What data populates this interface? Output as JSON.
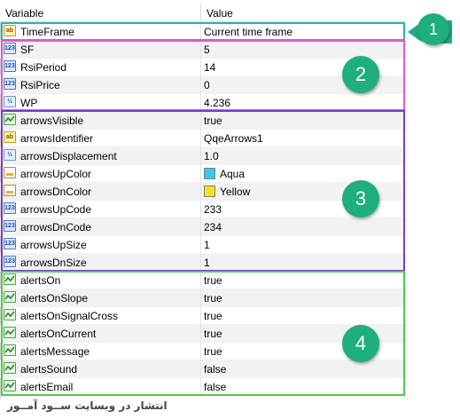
{
  "header": {
    "col1": "Variable",
    "col2": "Value"
  },
  "rows": [
    {
      "icon": "ab",
      "kind": "str",
      "name": "TimeFrame",
      "value": "Current time frame"
    },
    {
      "icon": "123",
      "kind": "num",
      "name": "SF",
      "value": "5"
    },
    {
      "icon": "123",
      "kind": "num",
      "name": "RsiPeriod",
      "value": "14"
    },
    {
      "icon": "123",
      "kind": "num",
      "name": "RsiPrice",
      "value": "0"
    },
    {
      "icon": "½",
      "kind": "dbl",
      "name": "WP",
      "value": "4.236"
    },
    {
      "icon": "bool",
      "kind": "bool",
      "name": "arrowsVisible",
      "value": "true"
    },
    {
      "icon": "ab",
      "kind": "str",
      "name": "arrowsIdentifier",
      "value": "QqeArrows1"
    },
    {
      "icon": "½",
      "kind": "dbl",
      "name": "arrowsDisplacement",
      "value": "1.0"
    },
    {
      "icon": "clr",
      "kind": "clr",
      "name": "arrowsUpColor",
      "value": "Aqua",
      "swatch": "#33ccee"
    },
    {
      "icon": "clr",
      "kind": "clr",
      "name": "arrowsDnColor",
      "value": "Yellow",
      "swatch": "#f5e21a"
    },
    {
      "icon": "123",
      "kind": "num",
      "name": "arrowsUpCode",
      "value": "233"
    },
    {
      "icon": "123",
      "kind": "num",
      "name": "arrowsDnCode",
      "value": "234"
    },
    {
      "icon": "123",
      "kind": "num",
      "name": "arrowsUpSize",
      "value": "1"
    },
    {
      "icon": "123",
      "kind": "num",
      "name": "arrowsDnSize",
      "value": "1"
    },
    {
      "icon": "bool",
      "kind": "bool",
      "name": "alertsOn",
      "value": "true"
    },
    {
      "icon": "bool",
      "kind": "bool",
      "name": "alertsOnSlope",
      "value": "true"
    },
    {
      "icon": "bool",
      "kind": "bool",
      "name": "alertsOnSignalCross",
      "value": "true"
    },
    {
      "icon": "bool",
      "kind": "bool",
      "name": "alertsOnCurrent",
      "value": "true"
    },
    {
      "icon": "bool",
      "kind": "bool",
      "name": "alertsMessage",
      "value": "true"
    },
    {
      "icon": "bool",
      "kind": "bool",
      "name": "alertsSound",
      "value": "false"
    },
    {
      "icon": "bool",
      "kind": "bool",
      "name": "alertsEmail",
      "value": "false"
    }
  ],
  "groups": [
    {
      "label": "1",
      "color": "#2bb3b0"
    },
    {
      "label": "2",
      "color": "#e05ad0"
    },
    {
      "label": "3",
      "color": "#7a3cc8"
    },
    {
      "label": "4",
      "color": "#4ccc4c"
    }
  ],
  "badge_color": "#1fae7e",
  "footer": "انتشار در وبسایت ســود آمــوز"
}
